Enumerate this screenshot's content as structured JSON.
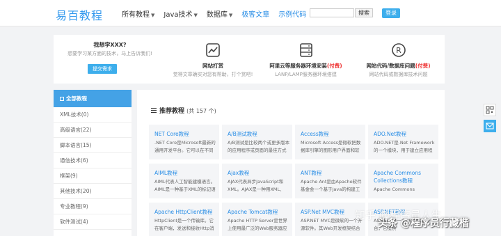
{
  "header": {
    "logo": "易百教程",
    "nav": [
      {
        "label": "所有教程",
        "dropdown": true
      },
      {
        "label": "Java技术",
        "dropdown": true
      },
      {
        "label": "数据库",
        "dropdown": true
      },
      {
        "label": "极客文章",
        "dropdown": false
      },
      {
        "label": "示例代码",
        "dropdown": false
      }
    ],
    "search_placeholder": "",
    "search_button": "搜索",
    "login_button": "登录"
  },
  "banner": {
    "learn_title": "我想学XXX?",
    "learn_sub": "想要学习某方面的技术，马上告诉我们!",
    "learn_button": "提交需求",
    "features": [
      {
        "icon": "chart-icon",
        "title": "网站打赏",
        "paid": "",
        "sub": "觉得文章确实对您有帮助，打个赏吧!"
      },
      {
        "icon": "server-icon",
        "title": "阿里云等服务器环境安装",
        "paid": "(付费)",
        "sub": "LANP/LAMP服务器环境搭建"
      },
      {
        "icon": "registered-icon",
        "title": "网站代码/数据库问题",
        "paid": "(付费)",
        "sub": "网站代码或数据库技术问题"
      }
    ]
  },
  "sidebar": {
    "head": "全部教程",
    "items": [
      "XML技术(0)",
      "高级语言(22)",
      "脚本语言(15)",
      "通信技术(6)",
      "框架(9)",
      "其他技术(20)",
      "专业教程(9)",
      "软件测试(4)"
    ]
  },
  "main": {
    "title": "推荐教程",
    "count": "(共 157 个)",
    "cards": [
      {
        "title": "NET Core教程",
        "desc": ".NET Core是Microsoft最新的通用开发平台。它可以在不同的平台"
      },
      {
        "title": "A/B测试教程",
        "desc": "A/B测试是比较两个或更多版本的应用程序或页面的最佳方式之一。"
      },
      {
        "title": "Access教程",
        "desc": "Microsoft Access是微软把数据库引擎的图形用户界面和软件开发工具"
      },
      {
        "title": "ADO.Net教程",
        "desc": "ADO.NET是.Net Framework的一个模块，用于建立应用程序和数据"
      },
      {
        "title": "AIML教程",
        "desc": "AIML代表人工智能建模语言。AIML是一种基于XML的标记语"
      },
      {
        "title": "Ajax教程",
        "desc": "AJAX代表异步JavaScript和XML。AJAX是一种用XML、"
      },
      {
        "title": "ANT教程",
        "desc": "Apache Ant是由Apache软件基金会一个基于Java的构建工具。"
      },
      {
        "title": "Apache Commons Collections教程",
        "desc": "Apache Commons Collections"
      },
      {
        "title": "Apache HttpClient教程",
        "desc": "HttpClient是一个传输库。它在客户端，发送和接收Http消息。它"
      },
      {
        "title": "Apache Tomcat教程",
        "desc": "Apache HTTP Server是世界上使用最广泛的Web服务器应用程序。"
      },
      {
        "title": "ASP.Net MVC教程",
        "desc": "ASP.NET MVC是微软的一个开源软件。其Web开发框架结合了"
      },
      {
        "title": "ASP.NET教程",
        "desc": "ASP.NET是一个Web开发平台，它提供"
      }
    ]
  },
  "watermark": {
    "line1": "知乎 @程序员人生",
    "line2": "头条 @程序员行藏楷"
  }
}
